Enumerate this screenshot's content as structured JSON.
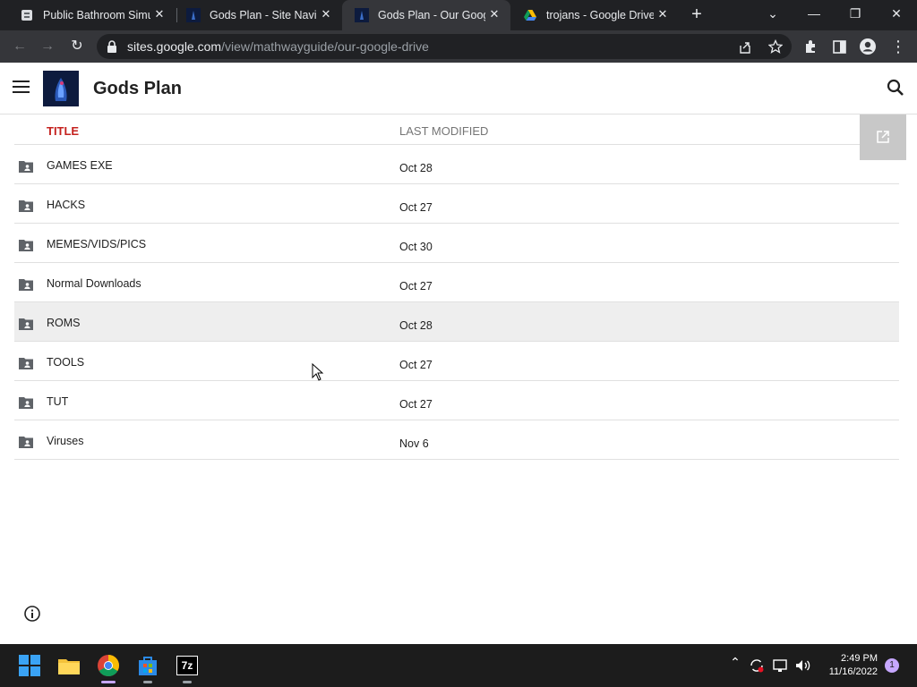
{
  "browser": {
    "tabs": [
      {
        "title": "Public Bathroom Simul",
        "favicon": "page-icon",
        "active": false
      },
      {
        "title": "Gods Plan - Site Navig",
        "favicon": "gods-plan-logo-icon",
        "active": false
      },
      {
        "title": "Gods Plan - Our Googl",
        "favicon": "gods-plan-logo-icon",
        "active": true
      },
      {
        "title": "trojans - Google Drive",
        "favicon": "google-drive-icon",
        "active": false
      }
    ],
    "url_host": "sites.google.com",
    "url_path": "/view/mathwayguide/our-google-drive"
  },
  "site": {
    "title": "Gods Plan",
    "columns": {
      "title": "TITLE",
      "modified": "LAST MODIFIED"
    },
    "rows": [
      {
        "name": "GAMES EXE",
        "date": "Oct 28"
      },
      {
        "name": "HACKS",
        "date": "Oct 27"
      },
      {
        "name": "MEMES/VIDS/PICS",
        "date": "Oct 30"
      },
      {
        "name": "Normal Downloads",
        "date": "Oct 27"
      },
      {
        "name": "ROMS",
        "date": "Oct 28"
      },
      {
        "name": "TOOLS",
        "date": "Oct 27"
      },
      {
        "name": "TUT",
        "date": "Oct 27"
      },
      {
        "name": "Viruses",
        "date": "Nov 6"
      }
    ],
    "highlighted_row": 4
  },
  "taskbar": {
    "time": "2:49 PM",
    "date": "11/16/2022",
    "notification_count": "1",
    "seven_zip_label": "7z"
  },
  "colors": {
    "title_column_accent": "#c5221f",
    "browser_chrome": "#35363a",
    "taskbar": "#1c1c1c"
  }
}
